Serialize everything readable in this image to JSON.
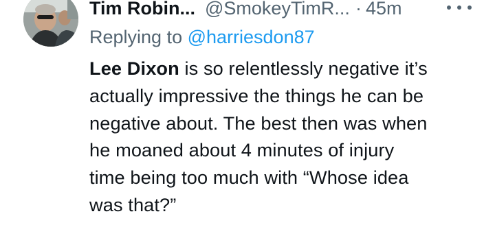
{
  "tweet": {
    "author": {
      "display_name": "Tim Robin...",
      "handle": "@SmokeyTimR...",
      "separator": "·",
      "time": "45m",
      "avatar_icon": "user-avatar-photo"
    },
    "more_icon": "more-horizontal-icon",
    "replying": {
      "prefix": "Replying to",
      "target": "@harriesdon87"
    },
    "text": {
      "bold_name": "Lee Dixon",
      "lines": [
        " is so relentlessly negative it’s",
        "actually impressive the things he can be",
        "negative about. The best then was when",
        "he moaned about 4 minutes of injury",
        "time being too much with “Whose idea",
        "was that?”"
      ]
    },
    "colors": {
      "text": "#0f1419",
      "secondary": "#536471",
      "link": "#1d9bf0"
    }
  }
}
